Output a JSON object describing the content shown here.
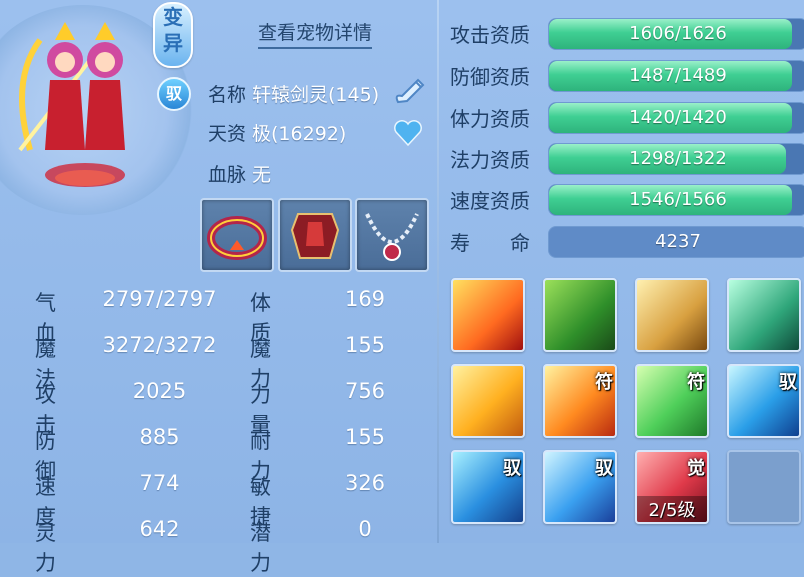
{
  "badges": {
    "bianyi": "变异",
    "yu": "驭"
  },
  "detail_link": "查看宠物详情",
  "info": {
    "name_label": "名称",
    "name_value": "轩辕剑灵(145)",
    "talent_label": "天资",
    "talent_value": "极(16292)",
    "bloodline_label": "血脉",
    "bloodline_value": "无"
  },
  "equipment": [
    {
      "icon": "red-gold-collar-icon"
    },
    {
      "icon": "red-armor-icon"
    },
    {
      "icon": "bead-necklace-icon"
    }
  ],
  "stats": [
    {
      "label": "气血",
      "value": "2797/2797"
    },
    {
      "label": "体质",
      "value": "169"
    },
    {
      "label": "魔法",
      "value": "3272/3272"
    },
    {
      "label": "魔力",
      "value": "155"
    },
    {
      "label": "攻击",
      "value": "2025"
    },
    {
      "label": "力量",
      "value": "756"
    },
    {
      "label": "防御",
      "value": "885"
    },
    {
      "label": "耐力",
      "value": "155"
    },
    {
      "label": "速度",
      "value": "774"
    },
    {
      "label": "敏捷",
      "value": "326"
    },
    {
      "label": "灵力",
      "value": "642"
    },
    {
      "label": "潜力",
      "value": "0"
    }
  ],
  "aptitudes": [
    {
      "label": "攻击资质",
      "text": "1606/1626",
      "fill": 0.94
    },
    {
      "label": "防御资质",
      "text": "1487/1489",
      "fill": 0.94
    },
    {
      "label": "体力资质",
      "text": "1420/1420",
      "fill": 0.94
    },
    {
      "label": "法力资质",
      "text": "1298/1322",
      "fill": 0.92
    },
    {
      "label": "速度资质",
      "text": "1546/1566",
      "fill": 0.94
    },
    {
      "label": "寿　　命",
      "text": "4237",
      "fill": 0
    }
  ],
  "skills": [
    {
      "icon": "flame-sword-icon",
      "tag": "",
      "level": ""
    },
    {
      "icon": "green-demon-icon",
      "tag": "",
      "level": ""
    },
    {
      "icon": "boot-icon",
      "tag": "",
      "level": ""
    },
    {
      "icon": "leaping-figure-icon",
      "tag": "",
      "level": ""
    },
    {
      "icon": "golden-blades-icon",
      "tag": "",
      "level": ""
    },
    {
      "icon": "shattering-burst-icon",
      "tag": "符",
      "level": ""
    },
    {
      "icon": "glowing-figure-icon",
      "tag": "符",
      "level": ""
    },
    {
      "icon": "storm-beast-icon",
      "tag": "驭",
      "level": ""
    },
    {
      "icon": "shield-icon",
      "tag": "驭",
      "level": ""
    },
    {
      "icon": "water-cyclone-icon",
      "tag": "驭",
      "level": ""
    },
    {
      "icon": "red-slash-icon",
      "tag": "觉",
      "level": "2/5级"
    },
    {
      "icon": "empty-slot-icon",
      "tag": "",
      "level": ""
    }
  ]
}
